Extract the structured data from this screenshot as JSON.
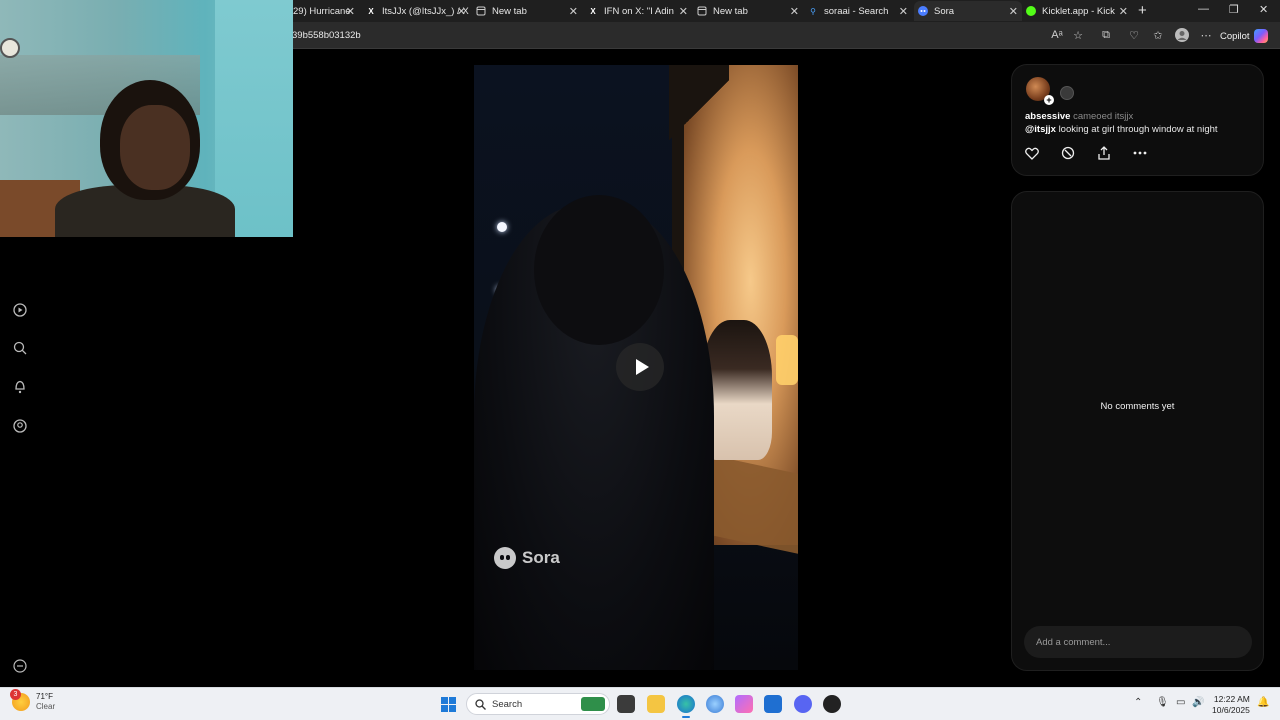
{
  "browser": {
    "tabs": [
      {
        "title": "29) Hurricane",
        "favicon": "tab-icon"
      },
      {
        "title": "ItsJJx (@ItsJJx_) / X",
        "favicon": "x-icon"
      },
      {
        "title": "New tab",
        "favicon": "newtab-icon"
      },
      {
        "title": "IFN on X: \"I Adin R",
        "favicon": "x-icon"
      },
      {
        "title": "New tab",
        "favicon": "newtab-icon"
      },
      {
        "title": "soraai - Search",
        "favicon": "search-icon"
      },
      {
        "title": "Sora",
        "favicon": "sora-icon",
        "active": true
      },
      {
        "title": "Kicklet.app - Kick C",
        "favicon": "kicklet-icon"
      }
    ],
    "url": "39b558b03132b",
    "copilot_label": "Copilot"
  },
  "sidebar": {
    "items": [
      "play-icon",
      "search-icon",
      "bell-icon",
      "profile-icon",
      "more-icon"
    ]
  },
  "video": {
    "watermark": "Sora",
    "state": "paused"
  },
  "post": {
    "username": "absessive",
    "cameo_text": "cameoed itsjjx",
    "mention": "@itsjjx",
    "caption": "looking at girl through window at night",
    "actions": [
      "heart-icon",
      "remix-icon",
      "share-icon",
      "more-icon"
    ]
  },
  "comments": {
    "empty_text": "No comments yet",
    "input_placeholder": "Add a comment..."
  },
  "taskbar": {
    "weather_temp": "71°F",
    "weather_cond": "Clear",
    "weather_badge": "3",
    "search_placeholder": "Search",
    "time": "12:22 AM",
    "date": "10/6/2025"
  },
  "colors": {
    "page_bg": "#000000",
    "panel_bg": "#0d0d0d",
    "taskbar_bg": "#eef0f4",
    "accent": "#1e7ad8"
  }
}
